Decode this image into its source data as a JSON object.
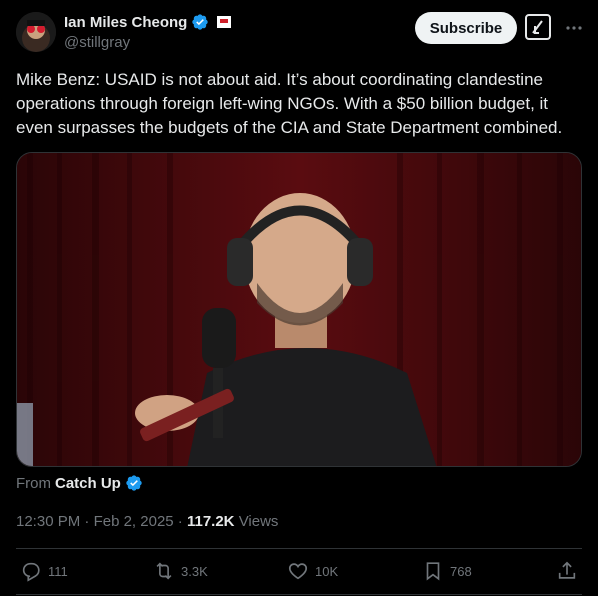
{
  "author": {
    "name": "Ian Miles Cheong",
    "handle": "@stillgray",
    "avatar_icon": "avatar-red-glasses",
    "verified_icon": "verified-badge-icon",
    "flag_icon": "flag-emoji-icon"
  },
  "header": {
    "subscribe_label": "Subscribe",
    "grok_icon": "grok-icon",
    "more_icon": "more-icon"
  },
  "tweet": {
    "text": "Mike Benz: USAID is not about aid. It’s about coordinating clandestine operations through foreign left-wing NGOs. With a $50 billion budget, it even surpasses the budgets of the CIA and State Department combined."
  },
  "media": {
    "type": "video-thumbnail",
    "from_label": "From",
    "source_name": "Catch Up"
  },
  "meta": {
    "time": "12:30 PM",
    "date": "Feb 2, 2025",
    "views_count": "117.2K",
    "views_label": "Views"
  },
  "actions": {
    "replies": "111",
    "reposts": "3.3K",
    "likes": "10K",
    "bookmarks": "768"
  },
  "colors": {
    "background": "#000000",
    "text": "#e7e9ea",
    "secondary": "#71767b",
    "accent": "#1d9bf0",
    "divider": "#2f3336"
  }
}
